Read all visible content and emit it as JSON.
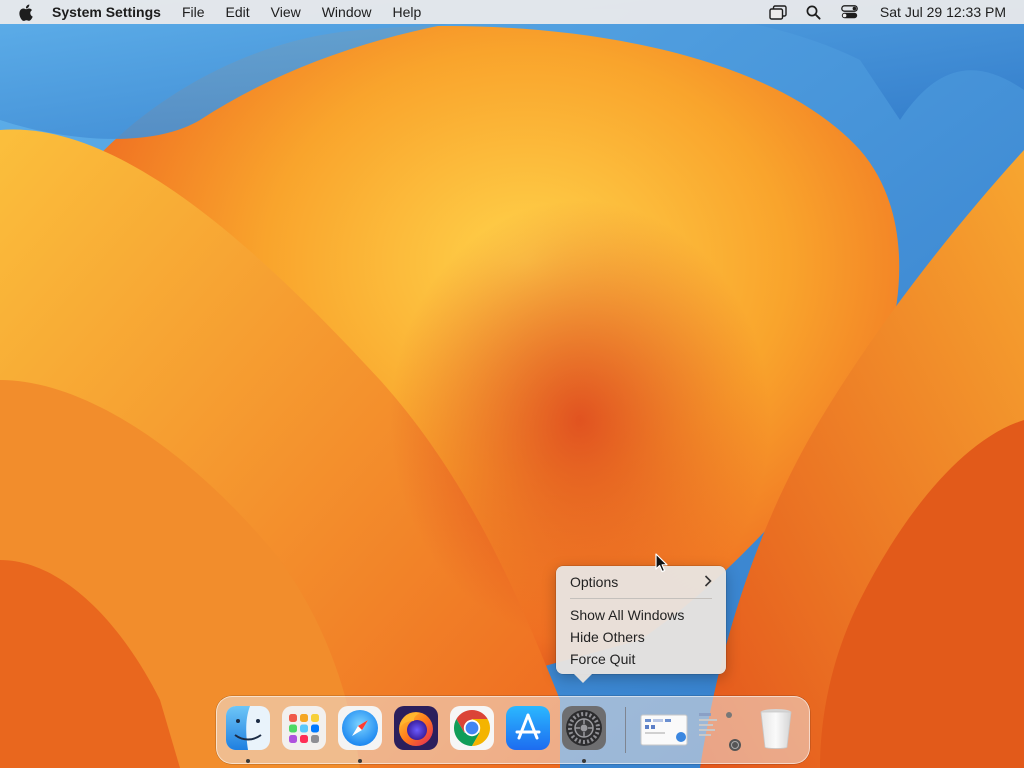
{
  "menubar": {
    "apple_icon": "apple-logo-icon",
    "app_name": "System Settings",
    "items": [
      "File",
      "Edit",
      "View",
      "Window",
      "Help"
    ],
    "status_icons": [
      "window-switch-icon",
      "spotlight-search-icon",
      "control-center-icon"
    ],
    "clock": "Sat Jul 29  12:33 PM"
  },
  "context_menu": {
    "items": [
      {
        "label": "Options",
        "has_submenu": true
      },
      {
        "label": "Show All Windows"
      },
      {
        "label": "Hide Others"
      },
      {
        "label": "Force Quit"
      }
    ]
  },
  "dock": {
    "apps": [
      {
        "name": "Finder",
        "icon": "finder-icon",
        "running": true
      },
      {
        "name": "Launchpad",
        "icon": "launchpad-icon",
        "running": false
      },
      {
        "name": "Safari",
        "icon": "safari-icon",
        "running": true
      },
      {
        "name": "Firefox",
        "icon": "firefox-icon",
        "running": false
      },
      {
        "name": "Chrome",
        "icon": "chrome-icon",
        "running": false
      },
      {
        "name": "App Store",
        "icon": "app-store-icon",
        "running": false
      },
      {
        "name": "System Settings",
        "icon": "system-settings-icon",
        "running": true
      }
    ],
    "others": [
      {
        "name": "Screenshot",
        "icon": "screenshot-thumbnail-icon"
      },
      {
        "name": "Downloads",
        "icon": "downloads-stack-icon"
      },
      {
        "name": "Trash",
        "icon": "trash-icon"
      }
    ]
  },
  "colors": {
    "wallpaper_blue": "#4a90d8",
    "wallpaper_orange": "#f08a2a",
    "wallpaper_yellow": "#f8c440",
    "wallpaper_red": "#d83a1a"
  }
}
